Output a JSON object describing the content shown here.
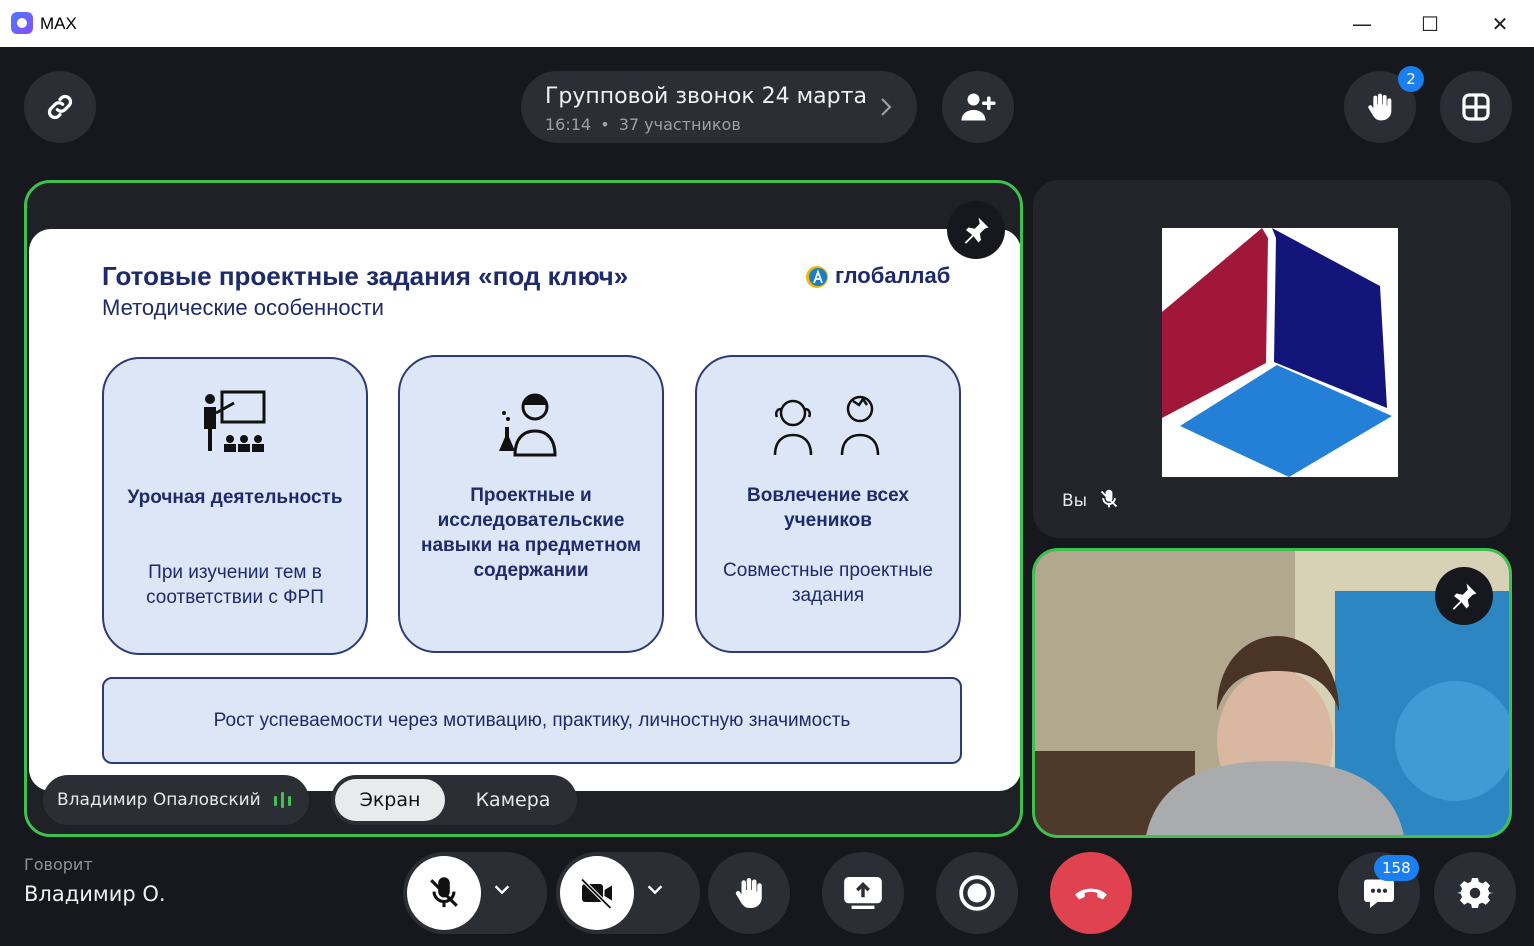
{
  "window": {
    "title": "MAX"
  },
  "header": {
    "call_title": "Групповой звонок 24 марта",
    "call_time": "16:14",
    "separator": "•",
    "participants": "37 участников",
    "raised_hands_count": "2"
  },
  "slide": {
    "title": "Готовые проектные задания «под ключ»",
    "subtitle": "Методические особенности",
    "brand": "глобаллаб",
    "cards": [
      {
        "title": "Урочная деятельность",
        "desc": "При изучении тем в соответствии с ФРП",
        "icon": "teacher-icon"
      },
      {
        "title": "Проектные и исследовательские навыки на предметном содержании",
        "desc": "",
        "icon": "scientist-icon"
      },
      {
        "title": "Вовлечение всех учеников",
        "desc": "Совместные проектные задания",
        "icon": "students-icon"
      }
    ],
    "footer": "Рост успеваемости через мотивацию, практику, личностную значимость"
  },
  "main_tile": {
    "presenter": "Владимир Опаловский",
    "tab_screen": "Экран",
    "tab_camera": "Камера"
  },
  "self_tile": {
    "label": "Вы"
  },
  "bottom": {
    "speaking_label": "Говорит",
    "speaking_name": "Владимир О.",
    "chat_count": "158"
  },
  "colors": {
    "accent_green": "#3fc14f",
    "end_call": "#e0424f",
    "badge_blue": "#1a7ff0"
  }
}
